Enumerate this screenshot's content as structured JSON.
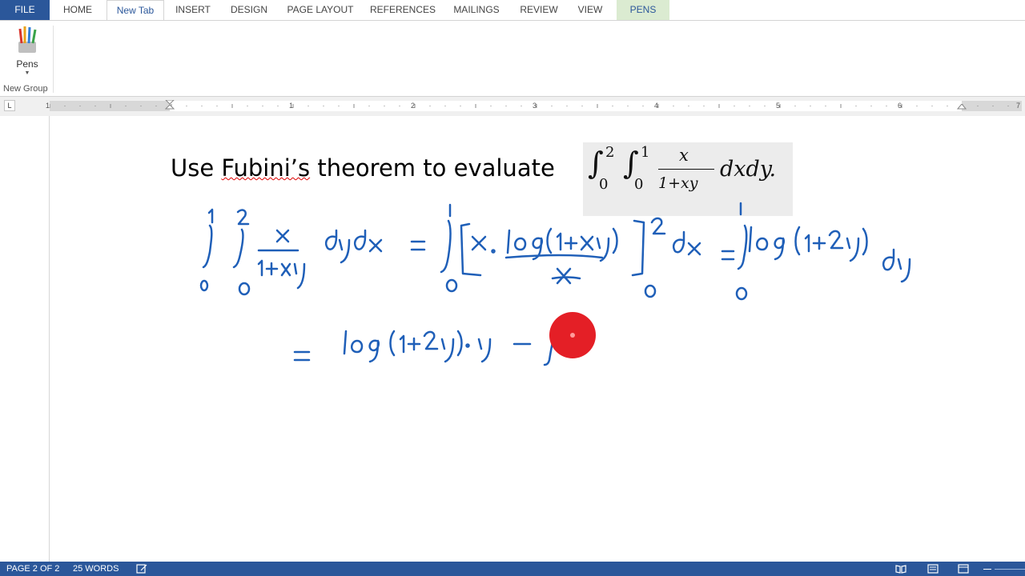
{
  "ribbon": {
    "tabs": [
      "FILE",
      "HOME",
      "New Tab",
      "INSERT",
      "DESIGN",
      "PAGE LAYOUT",
      "REFERENCES",
      "MAILINGS",
      "REVIEW",
      "VIEW",
      "PENS"
    ],
    "active_tab": "New Tab",
    "pens_button_label": "Pens",
    "group_label": "New Group"
  },
  "ruler": {
    "numbers": [
      "1",
      "1",
      "2",
      "3",
      "4",
      "5",
      "6",
      "7"
    ]
  },
  "document": {
    "heading_before": "Use ",
    "heading_fubini": "Fubini’s",
    "heading_after": " theorem to evaluate",
    "equation": {
      "outer_integral": "∫",
      "outer_upper": "2",
      "outer_lower": "0",
      "inner_integral": "∫",
      "inner_upper": "1",
      "inner_lower": "0",
      "numerator": "x",
      "denominator": "1+xy",
      "differentials": "dxdy."
    }
  },
  "statusbar": {
    "page": "PAGE 2 OF 2",
    "words": "25 WORDS"
  },
  "colors": {
    "brand_blue": "#2b579a",
    "pens_tab_bg": "#dbebd1",
    "ink_blue": "#1f5fb8",
    "pointer_red": "#e41f26"
  }
}
